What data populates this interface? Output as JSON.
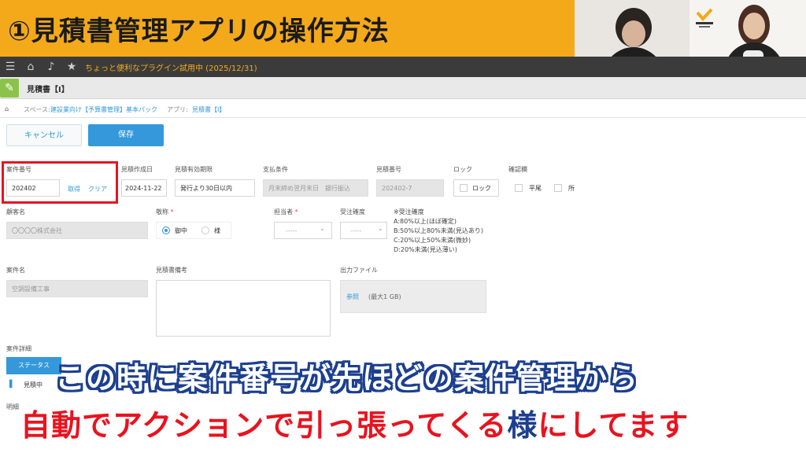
{
  "title": "①見積書管理アプリの操作方法",
  "topbar": {
    "trial_text": "ちょっと便利なプラグイン試用中 (2025/12/31)"
  },
  "app": {
    "title": "見積書【I】"
  },
  "breadcrumb": {
    "space_label": "スペース:",
    "space_link": "建設業向け【予算書管理】基本パック",
    "app_label": "アプリ:",
    "app_link": "見積書【I】"
  },
  "buttons": {
    "cancel": "キャンセル",
    "save": "保存"
  },
  "fields": {
    "case_no": {
      "label": "案件番号",
      "value": "202402",
      "get": "取得",
      "clear": "クリア"
    },
    "created_date": {
      "label": "見積作成日",
      "value": "2024-11-22"
    },
    "valid_period": {
      "label": "見積有効期限",
      "value": "発行より30日以内"
    },
    "payment": {
      "label": "支払条件",
      "value": "月末締め翌月末日　銀行振込"
    },
    "estimate_no": {
      "label": "見積番号",
      "value": "202402-7"
    },
    "lock": {
      "label": "ロック",
      "option": "ロック"
    },
    "confirm": {
      "label": "確認欄",
      "option1": "平尾",
      "option2": "所"
    },
    "customer": {
      "label": "顧客名",
      "value": "〇〇〇〇株式会社"
    },
    "honorific": {
      "label": "敬称",
      "opt1": "御中",
      "opt2": "様"
    },
    "assignee": {
      "label": "担当者",
      "value": "-----"
    },
    "certainty": {
      "label": "受注確度",
      "value": "-----"
    },
    "case_name": {
      "label": "案件名",
      "value": "空調設備工事"
    },
    "remarks": {
      "label": "見積書備考"
    },
    "output_file": {
      "label": "出力ファイル",
      "browse": "参照",
      "max": "(最大1 GB)"
    },
    "case_detail": {
      "label": "案件詳細"
    },
    "status_tab": "ステータス",
    "status_value": "見積中",
    "detail_label": "明細"
  },
  "certainty_note": [
    "※受注確度",
    "A:80%以上(ほぼ確定)",
    "B:50%以上80%未満(見込あり)",
    "C:20%以上50%未満(微妙)",
    "D:20%未満(見込薄い)"
  ],
  "subtitle": {
    "line1": "この時に案件番号が先ほどの案件管理から",
    "line2_red": "自動でアクションで引っ張ってくる",
    "line2_blue": "様",
    "line2_red2": "にしてます"
  },
  "colors": {
    "band": "#f4a91a",
    "accent": "#3498db",
    "highlight": "#e8131f",
    "subtitle_blue": "#1c3f8f"
  }
}
